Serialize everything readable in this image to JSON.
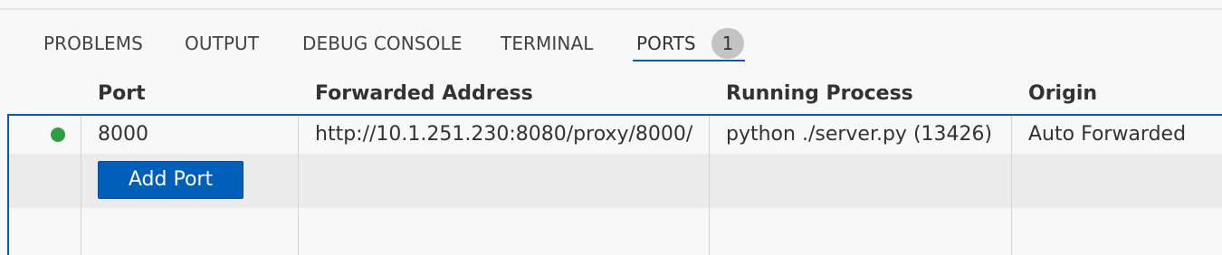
{
  "tabs": [
    {
      "label": "PROBLEMS"
    },
    {
      "label": "OUTPUT"
    },
    {
      "label": "DEBUG CONSOLE"
    },
    {
      "label": "TERMINAL"
    },
    {
      "label": "PORTS",
      "badge": "1"
    }
  ],
  "table": {
    "columns": [
      "Port",
      "Forwarded Address",
      "Running Process",
      "Origin"
    ],
    "rows": [
      {
        "status": "running",
        "port": "8000",
        "forwarded_address": "http://10.1.251.230:8080/proxy/8000/",
        "running_process": "python ./server.py (13426)",
        "origin": "Auto Forwarded"
      }
    ],
    "add_button_label": "Add Port"
  },
  "colors": {
    "accent": "#005fb8",
    "status_running": "#2ea043",
    "badge_bg": "#c4c4c4"
  }
}
